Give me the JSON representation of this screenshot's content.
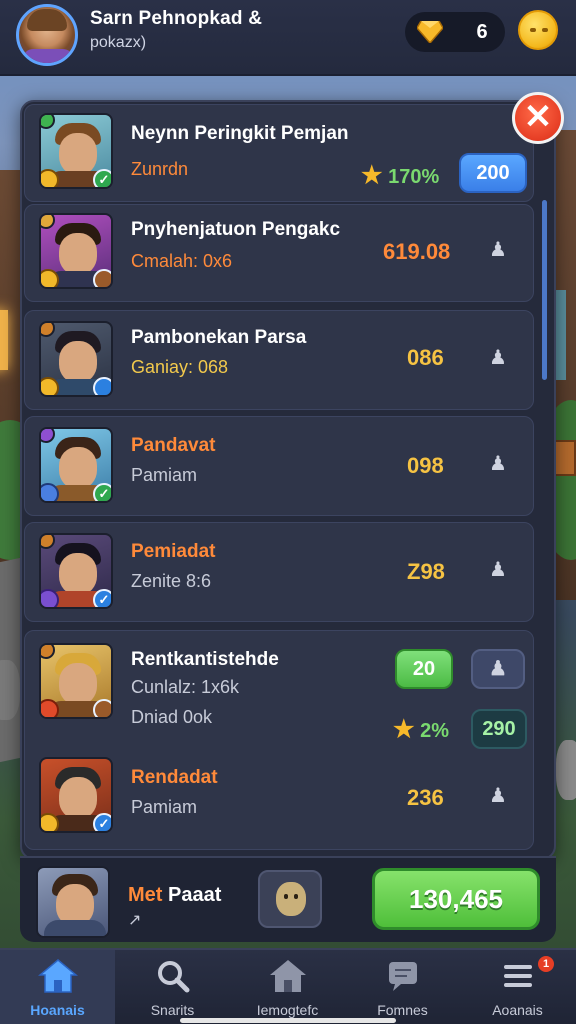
{
  "header": {
    "player_name": "Sarn Pehnopkad &",
    "player_sub": "pokazx)",
    "timer_glyph": "6"
  },
  "close_glyph": "✕",
  "leaderboard": {
    "rows": [
      {
        "name": "Neynn Peringkit Pemjan",
        "sub": "Zunrdn",
        "star_stat": "170%",
        "pill": "200"
      },
      {
        "name": "Pnyhenjatuon Pengakc",
        "sub": "Cmalah: 0x6",
        "score": "619.08"
      },
      {
        "name": "Pambonekan Parsa",
        "sub": "Ganiay: 068",
        "score": "086"
      },
      {
        "name": "Pandavat",
        "sub": "Pamiam",
        "score": "098"
      },
      {
        "name": "Pemiadat",
        "sub": "Zenite 8:6",
        "score": "Z98"
      },
      {
        "name": "Rentkantistehde",
        "sub": "Cunlalz: 1x6k",
        "sub2": "Dniad 0ok",
        "pill_green": "20",
        "star_stat": "2%",
        "pill_dark": "290"
      },
      {
        "name": "Rendadat",
        "sub": "Pamiam",
        "score": "236"
      }
    ]
  },
  "my_row": {
    "label_orange": "Met",
    "label_white": " Paaat",
    "pencil_glyph": "↗",
    "button": "130,465"
  },
  "nav": {
    "items": [
      {
        "label": "Hoanais",
        "icon": "home-icon"
      },
      {
        "label": "Snarits",
        "icon": "search-icon"
      },
      {
        "label": "Iemogtefc",
        "icon": "house-icon"
      },
      {
        "label": "Fomnes",
        "icon": "chat-icon"
      },
      {
        "label": "Aoanais",
        "icon": "menu-icon"
      }
    ],
    "badge": "1"
  },
  "colors": {
    "accent_blue": "#5aa7ff",
    "accent_green": "#4fbf3a",
    "accent_orange": "#ff8a3a",
    "score_gold": "#f6c343",
    "close_red": "#e63e25"
  }
}
